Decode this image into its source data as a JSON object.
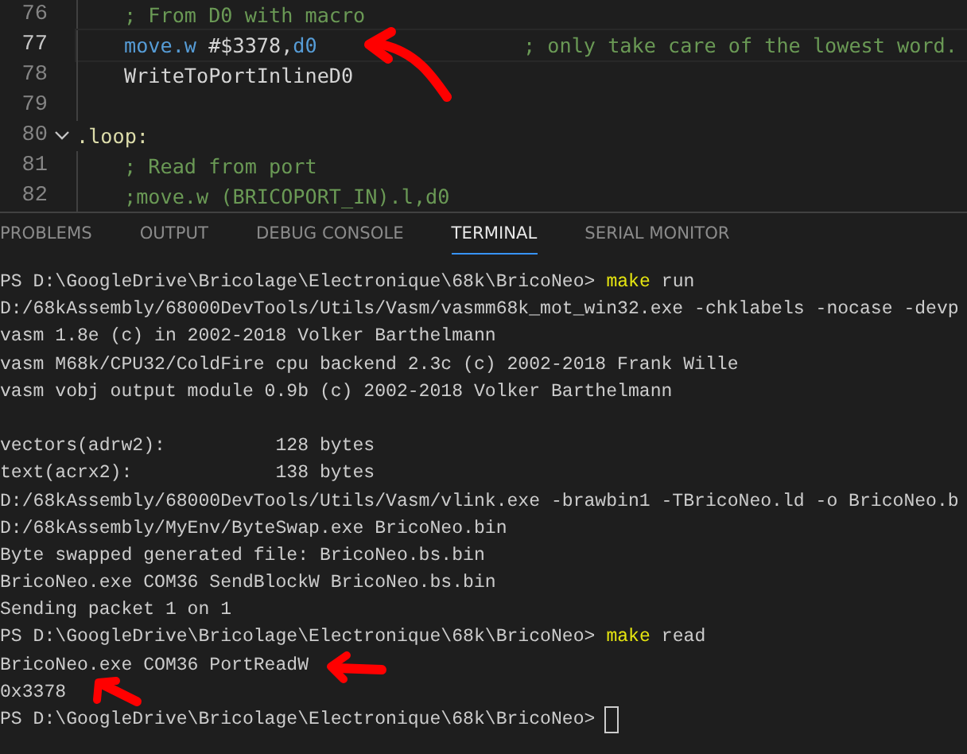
{
  "editor": {
    "lines": [
      {
        "number": "76",
        "kind": "code",
        "current": false,
        "fold": false,
        "tokens": [
          {
            "kind": "comment",
            "text": "; From D0 with macro"
          }
        ]
      },
      {
        "number": "77",
        "kind": "code",
        "current": true,
        "fold": false,
        "tokens": [
          {
            "kind": "keyword",
            "text": "move.w"
          },
          {
            "kind": "plain",
            "text": " #$3378,"
          },
          {
            "kind": "keyword",
            "text": "d0"
          },
          {
            "kind": "trailing-comment",
            "text": "; only take care of the lowest word."
          }
        ]
      },
      {
        "number": "78",
        "kind": "code",
        "current": false,
        "fold": false,
        "tokens": [
          {
            "kind": "plain",
            "text": "WriteToPortInlineD0"
          }
        ]
      },
      {
        "number": "79",
        "kind": "code",
        "current": false,
        "fold": false
      },
      {
        "number": "80",
        "kind": "label",
        "current": false,
        "fold": true,
        "tokens": [
          {
            "kind": "label",
            "text": ".loop:"
          }
        ]
      },
      {
        "number": "81",
        "kind": "code",
        "current": false,
        "fold": false,
        "tokens": [
          {
            "kind": "comment",
            "text": "; Read from port"
          }
        ]
      },
      {
        "number": "82",
        "kind": "code",
        "current": false,
        "fold": false,
        "tokens": [
          {
            "kind": "comment",
            "text": ";move.w (BRICOPORT_IN).l,d0"
          }
        ]
      }
    ]
  },
  "panel": {
    "tabs": [
      {
        "label": "PROBLEMS",
        "selected": false
      },
      {
        "label": "OUTPUT",
        "selected": false
      },
      {
        "label": "DEBUG CONSOLE",
        "selected": false
      },
      {
        "label": "TERMINAL",
        "selected": true
      },
      {
        "label": "SERIAL MONITOR",
        "selected": false
      }
    ]
  },
  "terminal": {
    "lines": [
      {
        "kind": "prompt",
        "prompt": "PS D:\\GoogleDrive\\Bricolage\\Electronique\\68k\\BricoNeo>",
        "command": "make",
        "args": "run"
      },
      {
        "kind": "output",
        "text": "D:/68kAssembly/68000DevTools/Utils/Vasm/vasmm68k_mot_win32.exe -chklabels -nocase -devp"
      },
      {
        "kind": "output",
        "text": "vasm 1.8e (c) in 2002-2018 Volker Barthelmann"
      },
      {
        "kind": "output",
        "text": "vasm M68k/CPU32/ColdFire cpu backend 2.3c (c) 2002-2018 Frank Wille"
      },
      {
        "kind": "output",
        "text": "vasm vobj output module 0.9b (c) 2002-2018 Volker Barthelmann"
      },
      {
        "kind": "blank"
      },
      {
        "kind": "output",
        "text": "vectors(adrw2):          128 bytes"
      },
      {
        "kind": "output",
        "text": "text(acrx2):             138 bytes"
      },
      {
        "kind": "output",
        "text": "D:/68kAssembly/68000DevTools/Utils/Vasm/vlink.exe -brawbin1 -TBricoNeo.ld -o BricoNeo.b"
      },
      {
        "kind": "output",
        "text": "D:/68kAssembly/MyEnv/ByteSwap.exe BricoNeo.bin"
      },
      {
        "kind": "output",
        "text": "Byte swapped generated file: BricoNeo.bs.bin"
      },
      {
        "kind": "output",
        "text": "BricoNeo.exe COM36 SendBlockW BricoNeo.bs.bin"
      },
      {
        "kind": "output",
        "text": "Sending packet 1 on 1"
      },
      {
        "kind": "prompt",
        "prompt": "PS D:\\GoogleDrive\\Bricolage\\Electronique\\68k\\BricoNeo>",
        "command": "make",
        "args": "read"
      },
      {
        "kind": "output",
        "text": "BricoNeo.exe COM36 PortReadW"
      },
      {
        "kind": "output",
        "text": "0x3378"
      },
      {
        "kind": "prompt",
        "prompt": "PS D:\\GoogleDrive\\Bricolage\\Electronique\\68k\\BricoNeo>",
        "cursor": true
      }
    ]
  }
}
